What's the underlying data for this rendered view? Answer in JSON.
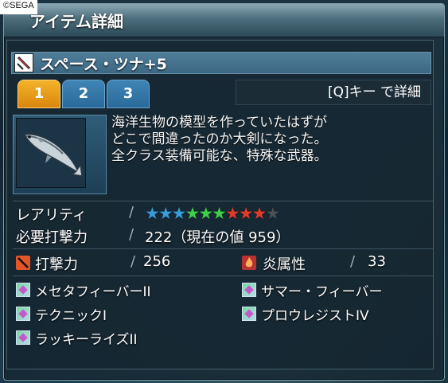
{
  "copyright": "©SEGA",
  "window": {
    "title": "アイテム詳細"
  },
  "item": {
    "name": "スペース・ツナ+5",
    "tabs": [
      "1",
      "2",
      "3"
    ],
    "active_tab": "1",
    "detail_hint": "[Q]キー で詳細",
    "description": [
      "海洋生物の模型を作っていたはずが",
      "どこで間違ったのか大剣になった。",
      "全クラス装備可能な、特殊な武器。"
    ]
  },
  "stats": {
    "rarity_label": "レアリティ",
    "rarity_stars": 9,
    "rarity_max": 10,
    "required_label": "必要打撃力",
    "required_value": "222（現在の値 959）",
    "attack_label": "打撃力",
    "attack_value": "256",
    "element_label": "炎属性",
    "element_value": "33"
  },
  "abilities": {
    "left": [
      "メセタフィーバーII",
      "テクニックI",
      "ラッキーライズII"
    ],
    "right": [
      "サマー・フィーバー",
      "プロウレジストIV"
    ]
  },
  "colors": {
    "star_blue": "#3a9cd8",
    "star_green": "#3fcf4a",
    "star_red": "#e23b2b",
    "star_empty": "#4a5258",
    "tab_active": "#e89a1c",
    "tab_inactive": "#2f74a6"
  }
}
